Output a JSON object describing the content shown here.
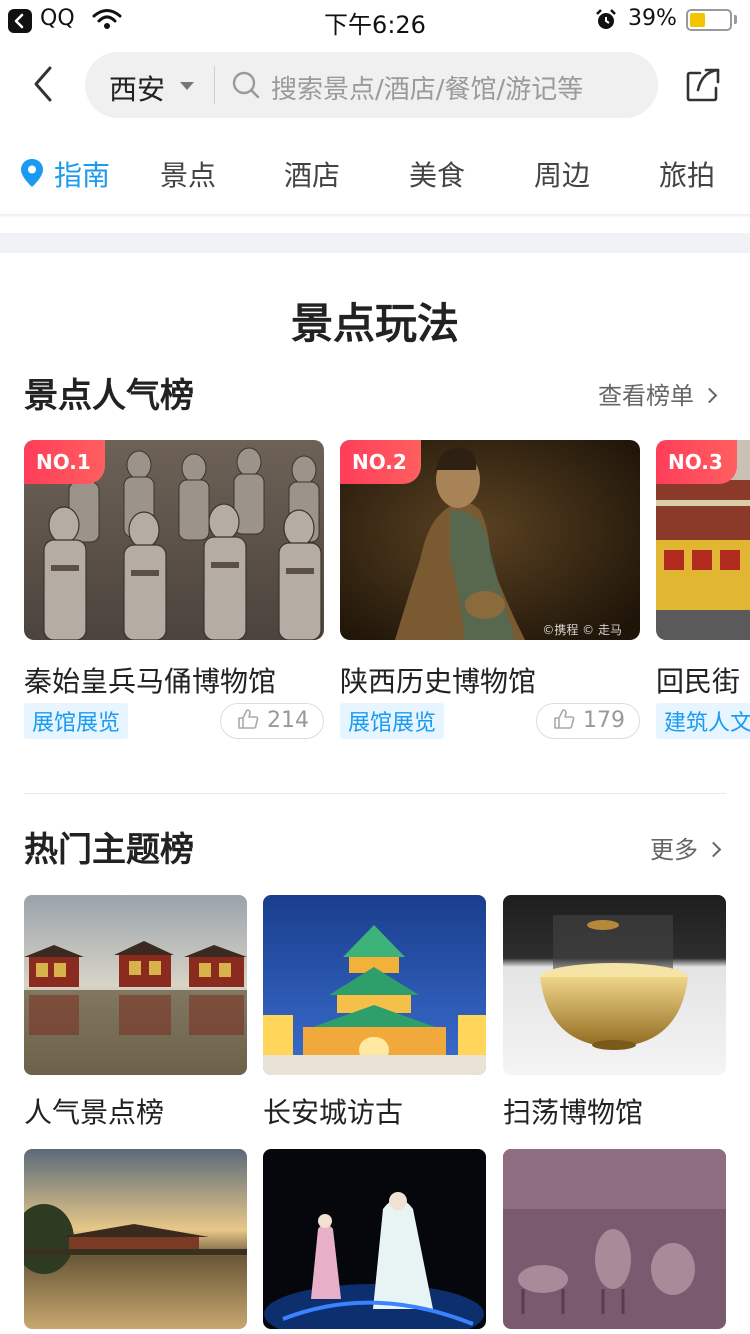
{
  "status_bar": {
    "app": "QQ",
    "time": "下午6:26",
    "battery": "39%",
    "battery_level": 0.39
  },
  "header": {
    "city": "西安",
    "search_placeholder": "搜索景点/酒店/餐馆/游记等"
  },
  "tabs": [
    {
      "label": "指南",
      "active": true
    },
    {
      "label": "景点"
    },
    {
      "label": "酒店"
    },
    {
      "label": "美食"
    },
    {
      "label": "周边"
    },
    {
      "label": "旅拍"
    }
  ],
  "section_title": "景点玩法",
  "ranking": {
    "heading": "景点人气榜",
    "more": "查看榜单",
    "items": [
      {
        "badge": "NO.1",
        "name": "秦始皇兵马俑博物馆",
        "tag": "展馆展览",
        "likes": "214"
      },
      {
        "badge": "NO.2",
        "name": "陕西历史博物馆",
        "tag": "展馆展览",
        "likes": "179",
        "watermark": "©携程 © 走马"
      },
      {
        "badge": "NO.3",
        "name": "回民街",
        "tag": "建筑人文"
      }
    ]
  },
  "themes": {
    "heading": "热门主题榜",
    "more": "更多",
    "items": [
      {
        "name": "人气景点榜"
      },
      {
        "name": "长安城访古"
      },
      {
        "name": "扫荡博物馆"
      },
      {
        "name": ""
      },
      {
        "name": ""
      },
      {
        "name": ""
      }
    ]
  },
  "colors": {
    "accent": "#1a9bf0",
    "badge": "#ff3d5a"
  }
}
